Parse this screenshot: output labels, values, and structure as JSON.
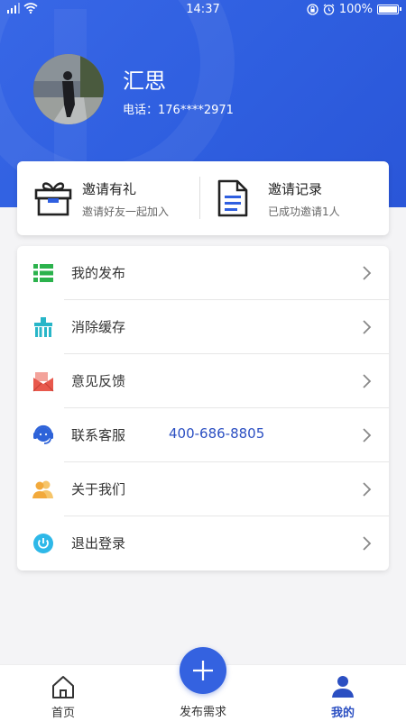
{
  "status_bar": {
    "time": "14:37",
    "battery": "100%",
    "battery_level": 1.0
  },
  "profile": {
    "name": "汇思",
    "phone": "电话：176****2971"
  },
  "invite": {
    "gift": {
      "title": "邀请有礼",
      "subtitle": "邀请好友一起加入",
      "icon": "gift-icon"
    },
    "record": {
      "title": "邀请记录",
      "subtitle": "已成功邀请1人",
      "icon": "document-icon"
    }
  },
  "menu": {
    "items": [
      {
        "label": "我的发布",
        "icon": "list-icon",
        "color": "#2bb24c"
      },
      {
        "label": "消除缓存",
        "icon": "broom-icon",
        "color": "#28b6c8"
      },
      {
        "label": "意见反馈",
        "icon": "feedback-mail-icon",
        "color": "#e8584c"
      },
      {
        "label": "联系客服",
        "value": "400-686-8805",
        "icon": "headset-icon",
        "color": "#2e63d9"
      },
      {
        "label": "关于我们",
        "icon": "users-icon",
        "color": "#f2a93b"
      },
      {
        "label": "退出登录",
        "icon": "power-icon",
        "color": "#2eb8e8"
      }
    ]
  },
  "bottom_nav": {
    "home": "首页",
    "publish": "发布需求",
    "mine": "我的"
  },
  "colors": {
    "primary": "#2f5fe0",
    "accent_text": "#2b4fc2"
  }
}
